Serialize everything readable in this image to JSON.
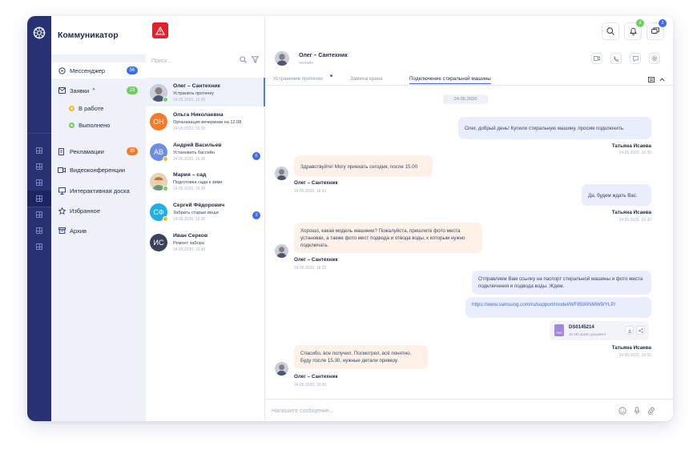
{
  "app": {
    "title": "Коммуникатор"
  },
  "colors": {
    "rail": "#283272",
    "accent": "#3b6cf0",
    "alert": "#e4202c",
    "bubble_out": "#eaedfb",
    "bubble_in": "#fdf1e8"
  },
  "nav": {
    "messenger": {
      "label": "Мессенджер",
      "badge": "56",
      "badge_color": "#3b6cf0"
    },
    "requests": {
      "label": "Заявки",
      "caret": "^",
      "badge": "23",
      "badge_color": "#6ccf5c"
    },
    "in_progress": {
      "label": "В работе",
      "dot_color": "#f5b82e"
    },
    "done": {
      "label": "Выполнено",
      "dot_color": "#6ccf5c"
    },
    "complaints": {
      "label": "Рекламации",
      "badge": "35",
      "badge_color": "#f57a29"
    },
    "video": {
      "label": "Видеоконференции"
    },
    "board": {
      "label": "Интерактивная доска"
    },
    "favorites": {
      "label": "Избранное"
    },
    "archive": {
      "label": "Архив"
    }
  },
  "header": {
    "bell_badge": "3",
    "chat_badge": "2"
  },
  "search": {
    "placeholder": "Поиск..."
  },
  "chats": [
    {
      "name": "Олег – Сантехник",
      "subject": "Устранить протечку",
      "time": "24.05.2020, 16:30",
      "initials": "",
      "avatar_color": "#7c8aa8",
      "status": "#6ccf5c",
      "count": ""
    },
    {
      "name": "Ольга Николаевна",
      "subject": "Организация вечеринки на 12.08",
      "time": "24.05.2020, 16:30",
      "initials": "ОН",
      "avatar_color": "#f57a29",
      "status": "",
      "count": ""
    },
    {
      "name": "Андрей Васильев",
      "subject": "Установить бассейн",
      "time": "24.05.2020, 16:30",
      "initials": "АВ",
      "avatar_color": "#6b8de6",
      "status": "#f5b82e",
      "count": "6"
    },
    {
      "name": "Мария – сад",
      "subject": "Подготовка сада к зиме",
      "time": "24.05.2020, 16:30",
      "initials": "",
      "avatar_color": "#d8b38a",
      "status": "#6ccf5c",
      "count": ""
    },
    {
      "name": "Сергей Фёдорович",
      "subject": "Забрать старые вещи",
      "time": "24.05.2020, 16:30",
      "initials": "СФ",
      "avatar_color": "#1faee8",
      "status": "#f5b82e",
      "count": "3"
    },
    {
      "name": "Иван Серков",
      "subject": "Ремонт забора",
      "time": "24.05.2020, 16:30",
      "initials": "ИС",
      "avatar_color": "#3a4358",
      "status": "",
      "count": ""
    }
  ],
  "conversation": {
    "peer": {
      "name": "Олег – Сантехник",
      "status": "онлайн"
    },
    "tabs": [
      {
        "label": "Устранение протечки"
      },
      {
        "label": "Замена крана"
      },
      {
        "label": "Подключение стиральной машины"
      }
    ],
    "date": "24.05.2020",
    "messages": [
      {
        "text": "Олег, добрый день! Купили стиральную машину, просим подключить.",
        "sender": "Татьяна Исаева",
        "time": "24.05.2020, 16:30"
      },
      {
        "text": "Здравствуйте! Могу приехать сегодня, после 15.00",
        "sender": "Олег – Сантехник",
        "time": "24.05.2020, 16:31"
      },
      {
        "text": "Да, будем ждать Вас.",
        "sender": "Татьяна Исаева",
        "time": "24.05.2020, 16:30"
      },
      {
        "text": "Хорошо, какая модель машинки? Пожалуйста, пришлите фото места установки, а также фото мест подвода и отвода воды, к которым нужно подключать.",
        "sender": "Олег – Сантехник",
        "time": "24.05.2020, 16:32"
      },
      {
        "text": "Отправляем Вам ссылку на паспорт стиральной машины и фото места подключения и подвода воды. Ждем.",
        "link": "https://www.samsung.com/ru/support/model/WF8590NMW9/YLP/",
        "file_name": "DS0145214",
        "file_meta": "10 Mb файл документ",
        "file_ext": "PNG",
        "sender": "Татьяна Исаева",
        "time": "24.05.2020, 16:30"
      },
      {
        "text": "Спасибо, все получил. Посмотрел, всё понятно. Буду после 15.30, нужные детали привезу.",
        "sender": "Олег – Сантехник",
        "time": "24.05.2020, 16:30"
      }
    ],
    "composer_placeholder": "Напишите сообщение..."
  }
}
